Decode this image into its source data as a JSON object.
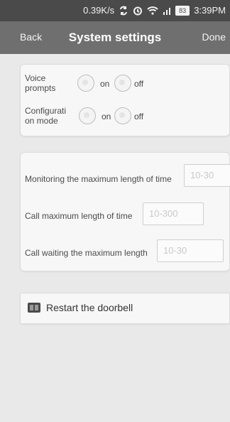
{
  "status_bar": {
    "network_speed": "0.39K/s",
    "battery_text": "83",
    "time": "3:39PM"
  },
  "nav": {
    "back_label": "Back",
    "title": "System settings",
    "done_label": "Done"
  },
  "prompts": {
    "voice_label": "Voice prompts",
    "voice_on_label": "on",
    "voice_off_label": "off",
    "config_label": "Configurati on mode",
    "config_on_label": "on",
    "config_off_label": "off"
  },
  "limits": {
    "monitoring_label": "Monitoring the maximum length of time",
    "monitoring_placeholder": "10-30",
    "call_max_label": "Call maximum length of time",
    "call_max_placeholder": "10-300",
    "call_wait_label": "Call waiting the maximum length",
    "call_wait_placeholder": "10-30"
  },
  "actions": {
    "restart_label": "Restart the doorbell"
  },
  "colors": {
    "status_bar_bg": "#4a4a4a",
    "nav_bg": "#6f6f6f",
    "page_bg": "#e9e9e9",
    "card_bg": "#f7f7f7"
  }
}
